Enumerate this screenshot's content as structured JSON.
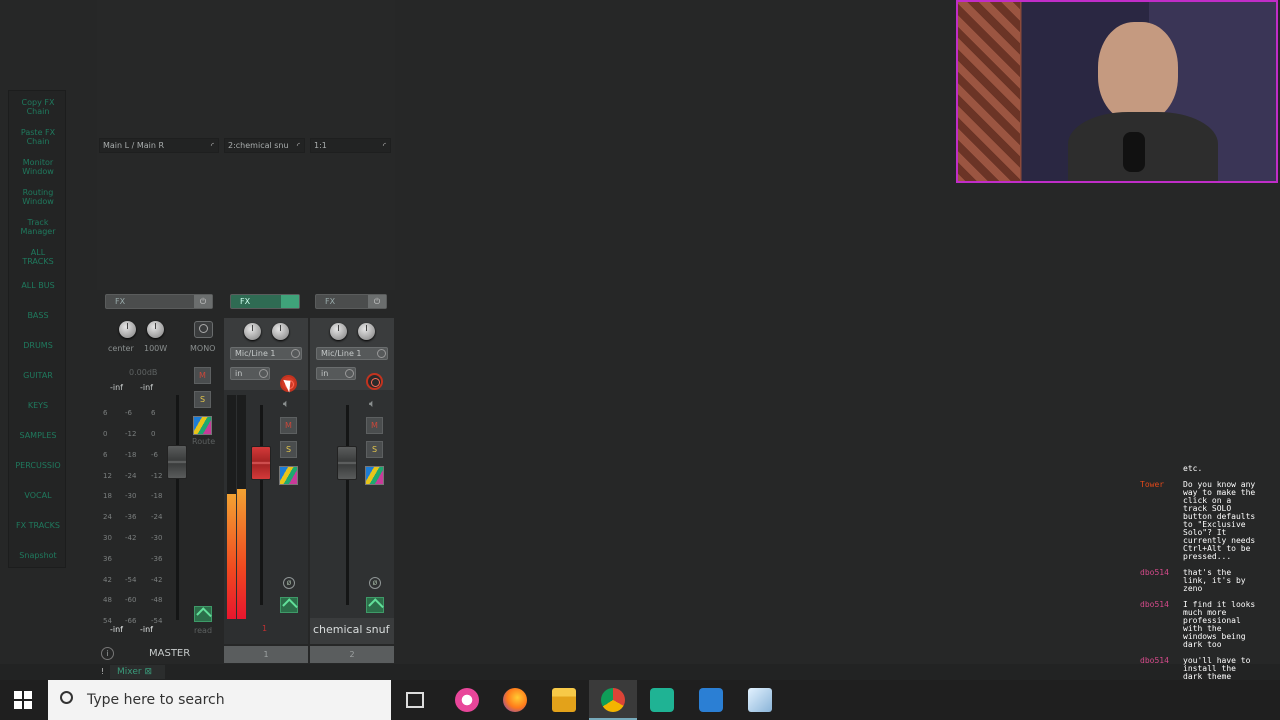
{
  "sidebar": {
    "items": [
      "Copy FX\nChain",
      "Paste FX\nChain",
      "Monitor\nWindow",
      "Routing\nWindow",
      "Track\nManager",
      "ALL\nTRACKS",
      "ALL BUS",
      "BASS",
      "DRUMS",
      "GUITAR",
      "KEYS",
      "SAMPLES",
      "PERCUSSIO",
      "VOCAL",
      "FX TRACKS",
      "Snapshot"
    ]
  },
  "io": {
    "master": "Main L / Main R",
    "track1": "2:chemical snu",
    "track2": "1:1"
  },
  "fx": {
    "label": "FX",
    "power_icon": "⏻"
  },
  "master": {
    "pan_label": "center",
    "width_label": "100W",
    "mono_label": "MONO",
    "mute_label": "M",
    "solo_label": "S",
    "route_label": "Route",
    "peak": "0.00dB",
    "inf_top_l": "-inf",
    "inf_top_r": "-inf",
    "inf_bot_l": "-inf",
    "inf_bot_r": "-inf",
    "auto_label": "read",
    "name": "MASTER",
    "info_icon": "i"
  },
  "scale": {
    "left": [
      "6",
      "0",
      "6",
      "12",
      "18",
      "24",
      "30",
      "36",
      "42",
      "48",
      "54"
    ],
    "mid": [
      "-6",
      "-12",
      "-18",
      "-24",
      "-30",
      "-36",
      "-42",
      "-54",
      "-60",
      "-66"
    ],
    "right": [
      "6",
      "0",
      "-6",
      "-12",
      "-18",
      "-24",
      "-30",
      "-36",
      "-42",
      "-48",
      "-54"
    ]
  },
  "tracks": [
    {
      "input": "Mic/Line 1",
      "in_label": "in",
      "mute": "M",
      "solo": "S",
      "name": "",
      "number": "1",
      "red_num": "1"
    },
    {
      "input": "Mic/Line 1",
      "in_label": "in",
      "mute": "M",
      "solo": "S",
      "name": "chemical snuf",
      "number": "2"
    }
  ],
  "tabs": {
    "mixer": "Mixer",
    "close_icon": "⊠",
    "pin": "!"
  },
  "taskbar": {
    "search_placeholder": "Type here to search"
  },
  "chat": [
    {
      "user": "",
      "text": "etc."
    },
    {
      "user": "Tower",
      "text": "Do you know any\nway to make the\nclick on a\ntrack SOLO\nbutton defaults\nto \"Exclusive\nSolo\"? It\ncurrently needs\nCtrl+Alt to be\npressed..."
    },
    {
      "user": "dbo514",
      "text": "that's the\nlink, it's by\nzeno"
    },
    {
      "user": "dbo514",
      "text": "I find it looks\nmuch more\nprofessional\nwith the\nwindows being\ndark too"
    },
    {
      "user": "dbo514",
      "text": "you'll have to\ninstall the\ndark theme\ncalled penumbra\nit's not that\nbad to install"
    }
  ]
}
